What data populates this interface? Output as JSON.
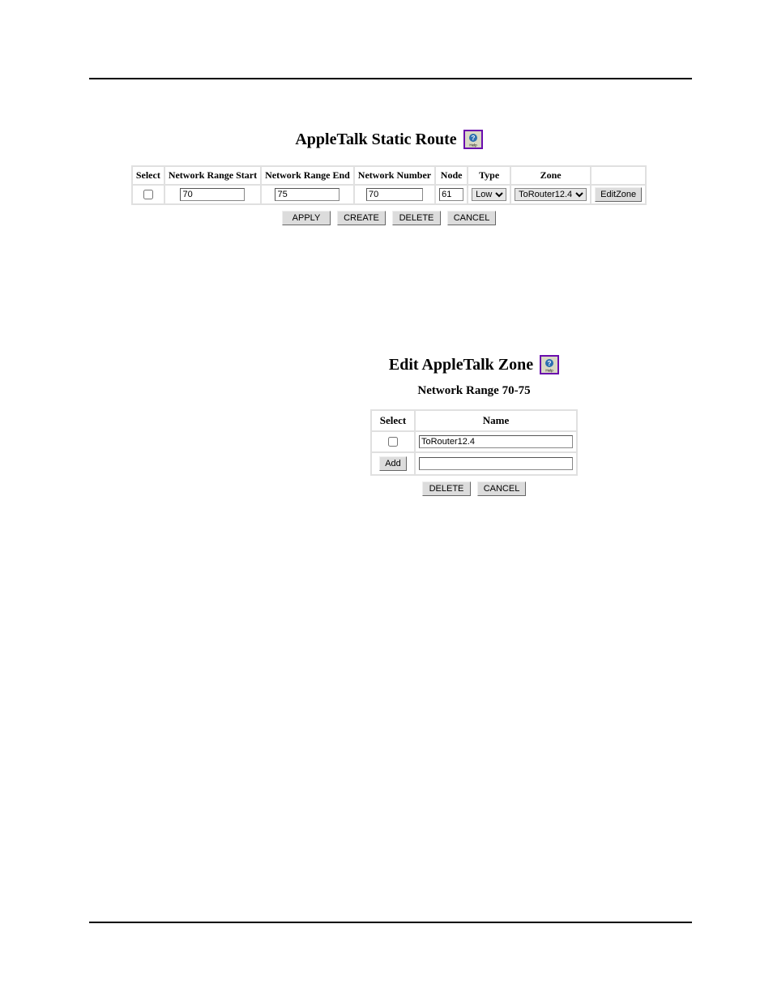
{
  "section1": {
    "title": "AppleTalk Static Route",
    "help_label": "Help",
    "columns": {
      "select": "Select",
      "range_start": "Network Range Start",
      "range_end": "Network Range End",
      "net_number": "Network Number",
      "node": "Node",
      "type": "Type",
      "zone": "Zone"
    },
    "row": {
      "range_start": "70",
      "range_end": "75",
      "net_number": "70",
      "node": "61",
      "type_option": "Low",
      "zone_option": "ToRouter12.4",
      "edit_zone_btn": "EditZone"
    },
    "buttons": {
      "apply": "APPLY",
      "create": "CREATE",
      "delete": "DELETE",
      "cancel": "CANCEL"
    }
  },
  "section2": {
    "title": "Edit AppleTalk Zone",
    "help_label": "Help",
    "subheading": "Network Range 70-75",
    "columns": {
      "select": "Select",
      "name": "Name"
    },
    "row1_name": "ToRouter12.4",
    "add_btn": "Add",
    "row2_name": "",
    "buttons": {
      "delete": "DELETE",
      "cancel": "CANCEL"
    }
  }
}
